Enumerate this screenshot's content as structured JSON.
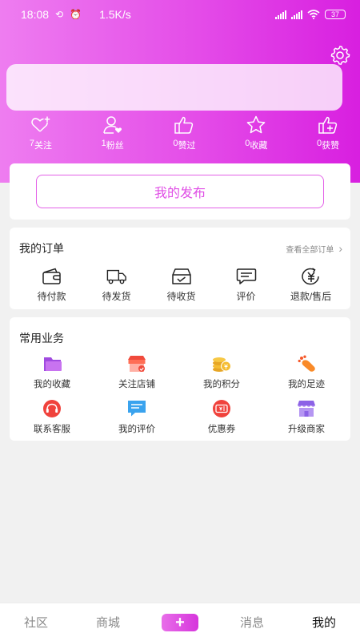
{
  "status_bar": {
    "time": "18:08",
    "speed": "1.5K/s",
    "battery": "37"
  },
  "stats": [
    {
      "icon": "heart-plus-icon",
      "count": "7",
      "label": "关注"
    },
    {
      "icon": "user-heart-icon",
      "count": "1",
      "label": "粉丝"
    },
    {
      "icon": "thumbs-up-icon",
      "count": "0",
      "label": "赞过"
    },
    {
      "icon": "star-icon",
      "count": "0",
      "label": "收藏"
    },
    {
      "icon": "thumbs-up-plus-icon",
      "count": "0",
      "label": "获赞"
    }
  ],
  "publish": {
    "label": "我的发布"
  },
  "orders": {
    "title": "我的订单",
    "view_all": "查看全部订单",
    "items": [
      {
        "icon": "wallet-icon",
        "label": "待付款"
      },
      {
        "icon": "truck-icon",
        "label": "待发货"
      },
      {
        "icon": "inbox-icon",
        "label": "待收货"
      },
      {
        "icon": "comment-icon",
        "label": "评价"
      },
      {
        "icon": "refund-icon",
        "label": "退款/售后"
      }
    ]
  },
  "services": {
    "title": "常用业务",
    "items": [
      {
        "icon": "folder-icon",
        "label": "我的收藏"
      },
      {
        "icon": "store-icon",
        "label": "关注店铺"
      },
      {
        "icon": "coins-icon",
        "label": "我的积分"
      },
      {
        "icon": "footprint-icon",
        "label": "我的足迹"
      },
      {
        "icon": "headset-icon",
        "label": "联系客服"
      },
      {
        "icon": "review-icon",
        "label": "我的评价"
      },
      {
        "icon": "coupon-icon",
        "label": "优惠券"
      },
      {
        "icon": "merchant-icon",
        "label": "升级商家"
      }
    ]
  },
  "tabbar": {
    "community": "社区",
    "mall": "商城",
    "plus": "+",
    "messages": "消息",
    "mine": "我的"
  },
  "colors": {
    "accent": "#e04fe6",
    "header_start": "#ee7df0",
    "header_end": "#d81fe0"
  }
}
